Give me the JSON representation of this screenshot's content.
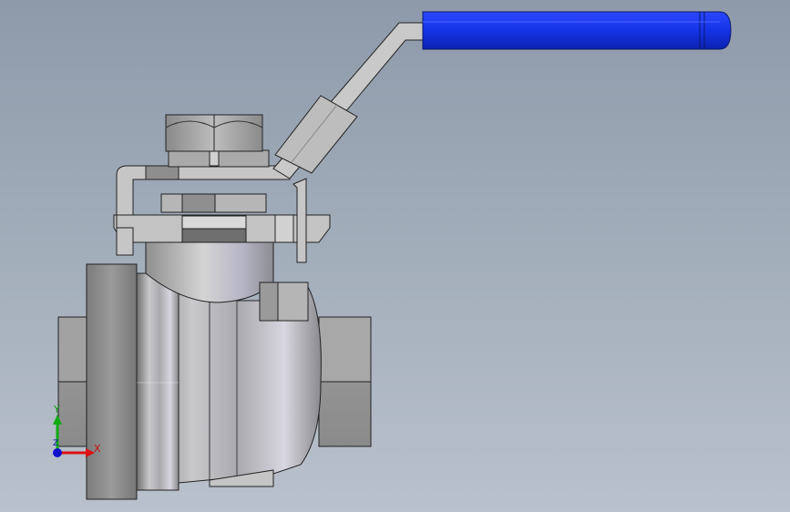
{
  "viewport": {
    "background_top": "#8e9aaa",
    "background_bottom": "#b9c1cc"
  },
  "model": {
    "name": "ball-valve",
    "handle_color": "#1533e6",
    "metal_color": "#b9b9b9"
  },
  "triad": {
    "x_label": "X",
    "y_label": "Y",
    "z_label": "Z",
    "x_color": "#dd1111",
    "y_color": "#11aa11",
    "z_color": "#1111cc"
  }
}
